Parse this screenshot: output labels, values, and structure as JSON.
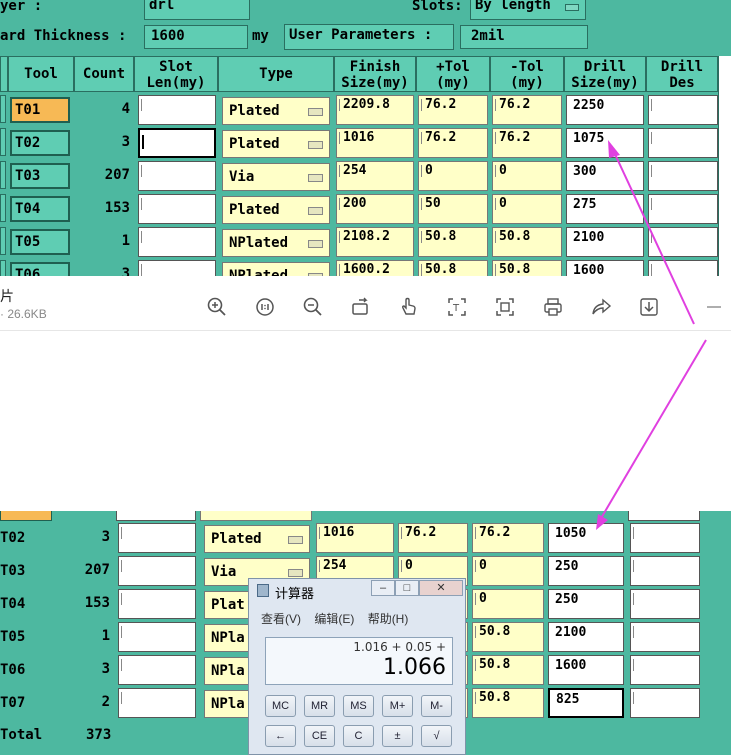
{
  "top": {
    "layer_label": "yer :",
    "layer_value": "drl",
    "slots_label": "Slots:",
    "slots_value": "By length",
    "thickness_label": "ard Thickness :",
    "thickness_value": "1600",
    "thickness_unit": "my",
    "user_params_label": "User Parameters :",
    "user_params_value": "2mil",
    "headers": [
      "Tool",
      "Count",
      "Slot\nLen(my)",
      "Type",
      "Finish\nSize(my)",
      "+Tol\n(my)",
      "-Tol\n(my)",
      "Drill\nSize(my)",
      "Drill\nDes"
    ],
    "rows": [
      {
        "tool": "T01",
        "count": "4",
        "type": "Plated",
        "finish": "2209.8",
        "ptol": "76.2",
        "ntol": "76.2",
        "drill": "2250"
      },
      {
        "tool": "T02",
        "count": "3",
        "type": "Plated",
        "finish": "1016",
        "ptol": "76.2",
        "ntol": "76.2",
        "drill": "1075"
      },
      {
        "tool": "T03",
        "count": "207",
        "type": "Via",
        "finish": "254",
        "ptol": "0",
        "ntol": "0",
        "drill": "300"
      },
      {
        "tool": "T04",
        "count": "153",
        "type": "Plated",
        "finish": "200",
        "ptol": "50",
        "ntol": "0",
        "drill": "275"
      },
      {
        "tool": "T05",
        "count": "1",
        "type": "NPlated",
        "finish": "2108.2",
        "ptol": "50.8",
        "ntol": "50.8",
        "drill": "2100"
      },
      {
        "tool": "T06",
        "count": "3",
        "type": "NPlated",
        "finish": "1600.2",
        "ptol": "50.8",
        "ntol": "50.8",
        "drill": "1600"
      }
    ]
  },
  "viewer": {
    "file_name": "片",
    "file_size": "· 26.6KB",
    "icons": [
      "zoom-in-icon",
      "actual-size-icon",
      "zoom-out-icon",
      "rotate-icon",
      "hand-icon",
      "ocr-icon",
      "crop-icon",
      "print-icon",
      "share-icon",
      "download-icon",
      "minimize-icon"
    ]
  },
  "bottom": {
    "rows": [
      {
        "tool": "T02",
        "count": "3",
        "type": "Plated",
        "finish": "1016",
        "ptol": "76.2",
        "ntol": "76.2",
        "drill": "1050"
      },
      {
        "tool": "T03",
        "count": "207",
        "type": "Via",
        "finish": "254",
        "ptol": "0",
        "ntol": "0",
        "drill": "250"
      },
      {
        "tool": "T04",
        "count": "153",
        "type": "Plat",
        "finish": "",
        "ptol": "",
        "ntol": "0",
        "drill": "250"
      },
      {
        "tool": "T05",
        "count": "1",
        "type": "NPla",
        "finish": "",
        "ptol": "",
        "ntol": "50.8",
        "drill": "2100"
      },
      {
        "tool": "T06",
        "count": "3",
        "type": "NPla",
        "finish": "",
        "ptol": "",
        "ntol": "50.8",
        "drill": "1600"
      },
      {
        "tool": "T07",
        "count": "2",
        "type": "NPla",
        "finish": "",
        "ptol": "",
        "ntol": "50.8",
        "drill": "825"
      }
    ],
    "total_label": "Total",
    "total_value": "373"
  },
  "calculator": {
    "title": "计算器",
    "menu": [
      "查看(V)",
      "编辑(E)",
      "帮助(H)"
    ],
    "expression": "1.016 + 0.05 +",
    "value": "1.066",
    "memory_buttons": [
      "MC",
      "MR",
      "MS",
      "M+",
      "M-"
    ],
    "row2_buttons": [
      "←",
      "CE",
      "C",
      "±",
      "√"
    ]
  },
  "colors": {
    "panel": "#4db8a0",
    "field": "#ffffc8",
    "selected_tool": "#f7b955",
    "arrow": "#e040e0"
  }
}
